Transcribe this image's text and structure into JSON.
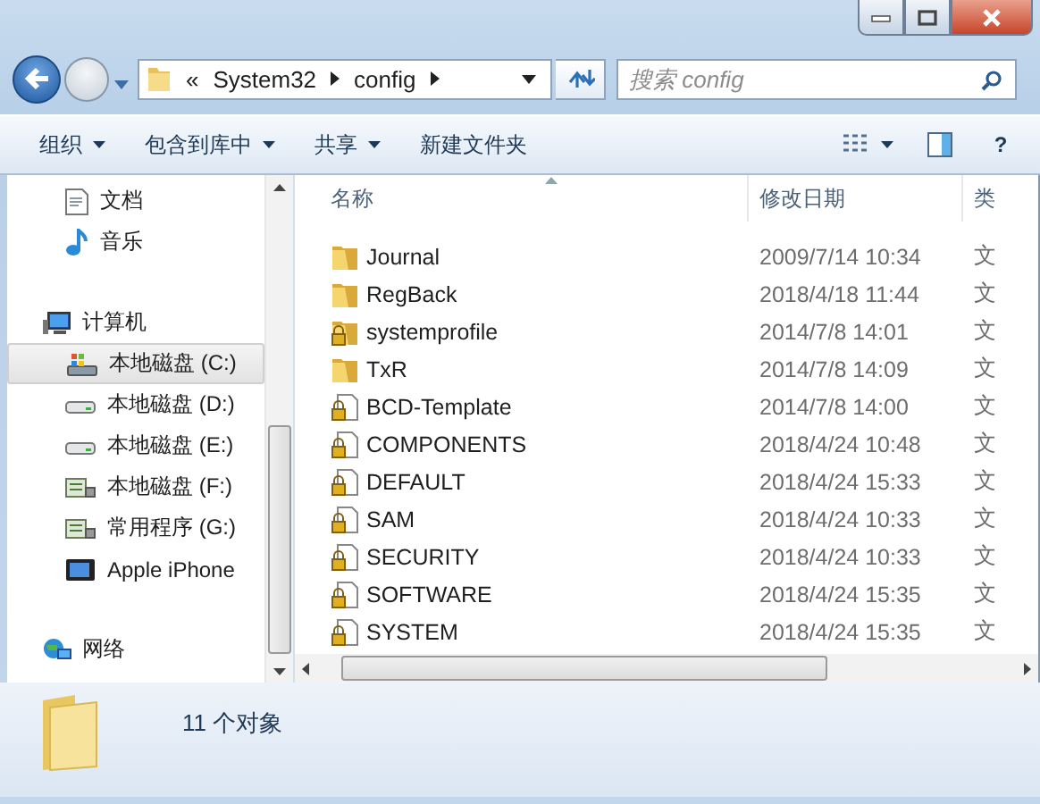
{
  "address": {
    "overflow": "«",
    "crumbs": [
      "System32",
      "config"
    ]
  },
  "search": {
    "placeholder": "搜索 config"
  },
  "toolbar": {
    "buttons": [
      {
        "label": "组织",
        "dropdown": true
      },
      {
        "label": "包含到库中",
        "dropdown": true
      },
      {
        "label": "共享",
        "dropdown": true
      },
      {
        "label": "新建文件夹",
        "dropdown": false
      }
    ],
    "help": "?"
  },
  "sidebar": {
    "sections": [
      {
        "children": [
          {
            "label": "文档",
            "kind": "document",
            "selected": false
          },
          {
            "label": "音乐",
            "kind": "music",
            "selected": false
          }
        ]
      },
      {
        "label": "计算机",
        "kind": "computer",
        "selected": false,
        "children": [
          {
            "label": "本地磁盘 (C:)",
            "kind": "system-drive",
            "selected": true
          },
          {
            "label": "本地磁盘 (D:)",
            "kind": "drive",
            "selected": false
          },
          {
            "label": "本地磁盘 (E:)",
            "kind": "drive",
            "selected": false
          },
          {
            "label": "本地磁盘 (F:)",
            "kind": "network-drive",
            "selected": false
          },
          {
            "label": "常用程序 (G:)",
            "kind": "network-drive",
            "selected": false
          },
          {
            "label": "Apple iPhone",
            "kind": "phone",
            "selected": false
          }
        ]
      },
      {
        "label": "网络",
        "kind": "network",
        "selected": false
      }
    ]
  },
  "table": {
    "columns": [
      "名称",
      "修改日期",
      "类"
    ],
    "rows": [
      {
        "kind": "folder",
        "name": "Journal",
        "date": "2009/7/14 10:34",
        "type": "文"
      },
      {
        "kind": "folder",
        "name": "RegBack",
        "date": "2018/4/18 11:44",
        "type": "文"
      },
      {
        "kind": "locked-folder",
        "name": "systemprofile",
        "date": "2014/7/8 14:01",
        "type": "文"
      },
      {
        "kind": "folder",
        "name": "TxR",
        "date": "2014/7/8 14:09",
        "type": "文"
      },
      {
        "kind": "locked-file",
        "name": "BCD-Template",
        "date": "2014/7/8 14:00",
        "type": "文"
      },
      {
        "kind": "locked-file",
        "name": "COMPONENTS",
        "date": "2018/4/24 10:48",
        "type": "文"
      },
      {
        "kind": "locked-file",
        "name": "DEFAULT",
        "date": "2018/4/24 15:33",
        "type": "文"
      },
      {
        "kind": "locked-file",
        "name": "SAM",
        "date": "2018/4/24 10:33",
        "type": "文"
      },
      {
        "kind": "locked-file",
        "name": "SECURITY",
        "date": "2018/4/24 10:33",
        "type": "文"
      },
      {
        "kind": "locked-file",
        "name": "SOFTWARE",
        "date": "2018/4/24 15:35",
        "type": "文"
      },
      {
        "kind": "locked-file",
        "name": "SYSTEM",
        "date": "2018/4/24 15:35",
        "type": "文"
      }
    ]
  },
  "status_bar": {
    "count": "11 个对象"
  }
}
